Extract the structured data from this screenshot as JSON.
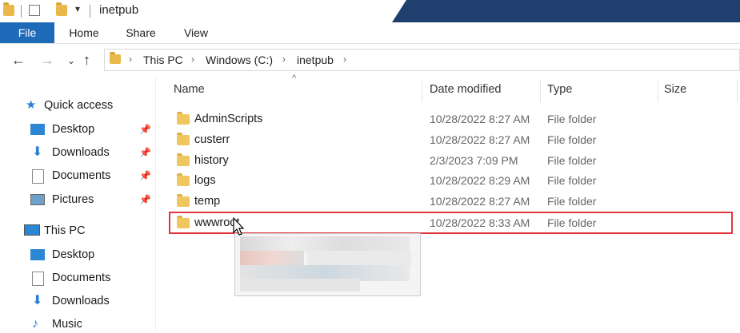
{
  "window": {
    "title": "inetpub"
  },
  "ribbon": {
    "tabs": [
      "File",
      "Home",
      "Share",
      "View"
    ]
  },
  "address": {
    "crumbs": [
      "This PC",
      "Windows (C:)",
      "inetpub"
    ]
  },
  "nav": {
    "quick_access": "Quick access",
    "quick_items": [
      "Desktop",
      "Downloads",
      "Documents",
      "Pictures"
    ],
    "this_pc": "This PC",
    "pc_items": [
      "Desktop",
      "Documents",
      "Downloads",
      "Music"
    ]
  },
  "columns": {
    "name": "Name",
    "date": "Date modified",
    "type": "Type",
    "size": "Size"
  },
  "files": [
    {
      "name": "AdminScripts",
      "date": "10/28/2022 8:27 AM",
      "type": "File folder"
    },
    {
      "name": "custerr",
      "date": "10/28/2022 8:27 AM",
      "type": "File folder"
    },
    {
      "name": "history",
      "date": "2/3/2023 7:09 PM",
      "type": "File folder"
    },
    {
      "name": "logs",
      "date": "10/28/2022 8:29 AM",
      "type": "File folder"
    },
    {
      "name": "temp",
      "date": "10/28/2022 8:27 AM",
      "type": "File folder"
    },
    {
      "name": "wwwroot",
      "date": "10/28/2022 8:33 AM",
      "type": "File folder"
    }
  ],
  "colors": {
    "accent": "#1e69b8",
    "highlight": "#e2363c",
    "titlebar_dark": "#1f3f6e"
  }
}
